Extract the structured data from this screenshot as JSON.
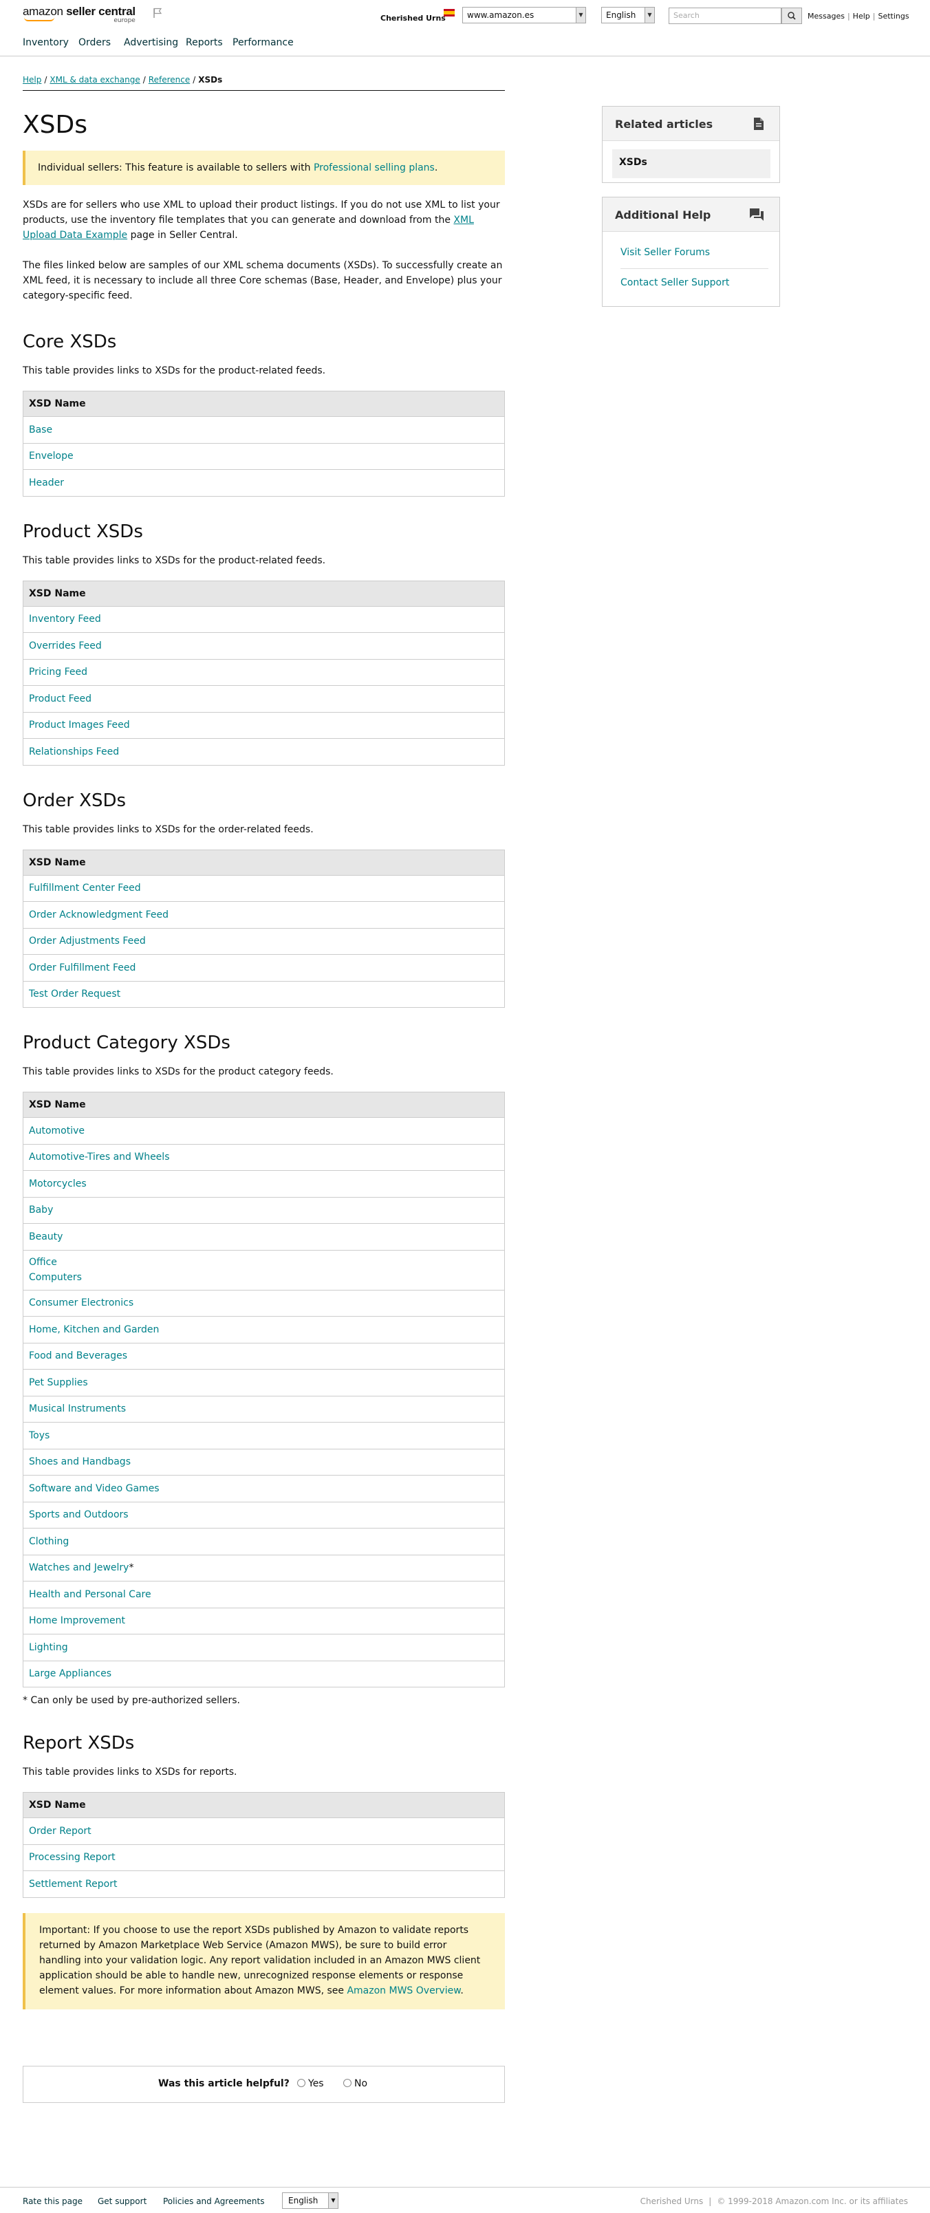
{
  "header": {
    "logo_text_regular": "amazon",
    "logo_text_bold": " seller central",
    "logo_sub": "europe",
    "seller_name": "Cherished Urns",
    "marketplace": "www.amazon.es",
    "language": "English",
    "search_placeholder": "Search",
    "links": [
      "Messages",
      "Help",
      "Settings"
    ]
  },
  "nav": [
    "Inventory",
    "Orders",
    "Advertising",
    "Reports",
    "Performance"
  ],
  "breadcrumb": {
    "items": [
      "Help",
      "XML & data exchange",
      "Reference"
    ],
    "current": "XSDs"
  },
  "page": {
    "title": "XSDs",
    "notice": {
      "bold": "Individual sellers:",
      "text": " This feature is available to sellers with ",
      "link": "Professional selling plans",
      "end": "."
    },
    "intro1": {
      "before": "XSDs are for sellers who use XML to upload their product listings. If you do not use XML to list your products, use the inventory file templates that you can generate and download from the ",
      "link": "XML Upload Data Example",
      "after": " page in Seller Central."
    },
    "intro2": "The files linked below are samples of our XML schema documents (XSDs). To successfully create an XML feed, it is necessary to include all three Core schemas (Base, Header, and Envelope) plus your category-specific feed."
  },
  "column_header": "XSD Name",
  "sections": {
    "core": {
      "title": "Core XSDs",
      "desc": "This table provides links to XSDs for the product-related feeds.",
      "rows": [
        "Base",
        "Envelope",
        "Header"
      ]
    },
    "product": {
      "title": "Product XSDs",
      "desc": "This table provides links to XSDs for the product-related feeds.",
      "rows": [
        "Inventory Feed",
        "Overrides Feed",
        "Pricing Feed",
        "Product Feed",
        "Product Images Feed",
        "Relationships Feed"
      ]
    },
    "order": {
      "title": "Order XSDs",
      "desc": "This table provides links to XSDs for the order-related feeds.",
      "rows": [
        "Fulfillment Center Feed",
        "Order Acknowledgment Feed",
        "Order Adjustments Feed",
        "Order Fulfillment Feed",
        "Test Order Request"
      ]
    },
    "category": {
      "title": "Product Category XSDs",
      "desc": "This table provides links to XSDs for the product category feeds.",
      "rows": [
        "Automotive",
        "Automotive-Tires and Wheels",
        "Motorcycles",
        "Baby",
        "Beauty",
        "Office",
        "Computers",
        "Consumer Electronics",
        "Home, Kitchen and Garden",
        "Food and Beverages",
        "Pet Supplies",
        "Musical Instruments",
        "Toys",
        "Shoes and Handbags",
        "Software and Video Games",
        "Sports and Outdoors",
        "Clothing",
        "Watches and Jewelry",
        "Health and Personal Care",
        "Home Improvement",
        "Lighting",
        "Large Appliances"
      ],
      "asterisk_mark": "*",
      "footnote": "* Can only be used by pre-authorized sellers."
    },
    "report": {
      "title": "Report XSDs",
      "desc": "This table provides links to XSDs for reports.",
      "rows": [
        "Order Report",
        "Processing Report",
        "Settlement Report"
      ]
    }
  },
  "important": {
    "text": "Important: If you choose to use the report XSDs published by Amazon to validate reports returned by Amazon Marketplace Web Service (Amazon MWS), be sure to build error handling into your validation logic. Any report validation included in an Amazon MWS client application should be able to handle new, unrecognized response elements or response element values. For more information about Amazon MWS, see ",
    "link": "Amazon MWS Overview",
    "end": "."
  },
  "feedback": {
    "question": "Was this article helpful?",
    "yes": "Yes",
    "no": "No"
  },
  "sidebar": {
    "related_title": "Related articles",
    "related_item": "XSDs",
    "help_title": "Additional Help",
    "help_links": [
      "Visit Seller Forums",
      "Contact Seller Support"
    ]
  },
  "footer": {
    "links": [
      "Rate this page",
      "Get support",
      "Policies and Agreements"
    ],
    "language": "English",
    "seller": "Cherished Urns",
    "copyright": "© 1999-2018 Amazon.com Inc. or its affiliates"
  },
  "colors": {
    "link": "#00818a",
    "notice_bg": "#fdf4c9",
    "table_header_bg": "#e6e6e6",
    "nav_text": "#002f36"
  }
}
